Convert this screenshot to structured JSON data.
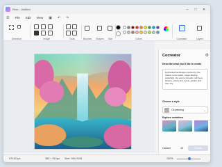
{
  "window": {
    "title": "Rem - Untitled"
  },
  "menubar": {
    "items": [
      "File",
      "Edit",
      "View"
    ]
  },
  "ribbon": {
    "groups": [
      "Selection",
      "Image",
      "Tools",
      "Brushes",
      "Shapes",
      "Size",
      "Colors",
      "Cocreator",
      "Layers"
    ]
  },
  "colors": {
    "palette_row1": [
      "#000000",
      "#7f7f7f",
      "#880015",
      "#ed1c24",
      "#ff7f27",
      "#fff200",
      "#22b14c",
      "#00a2e8",
      "#3f48cc",
      "#a349a4"
    ],
    "palette_row2": [
      "#ffffff",
      "#c3c3c3",
      "#b97a57",
      "#ffaec9",
      "#ffc90e",
      "#efe4b0",
      "#b5e61d",
      "#99d9ea",
      "#7092be",
      "#c8bfe7"
    ],
    "selected": "#000000"
  },
  "panel": {
    "title": "Cocreator",
    "describe_label": "Describe what you'd like to create",
    "prompt": "Enchanted landscape inspired by the beauty in the world, magic flowing waterfalls, the aurora borealis, tall trees, flowers, plants and a pink, golden and blue sky",
    "style_label": "Choose a style",
    "style_value": "Oil painting",
    "variations_label": "Explore variations",
    "cancel_label": "Cancel",
    "credits": "48",
    "create_label": "Create"
  },
  "statusbar": {
    "position": "97x121px",
    "selection": "380 × 512px",
    "size": "Size: 984.3 KB",
    "zoom": "100%"
  }
}
